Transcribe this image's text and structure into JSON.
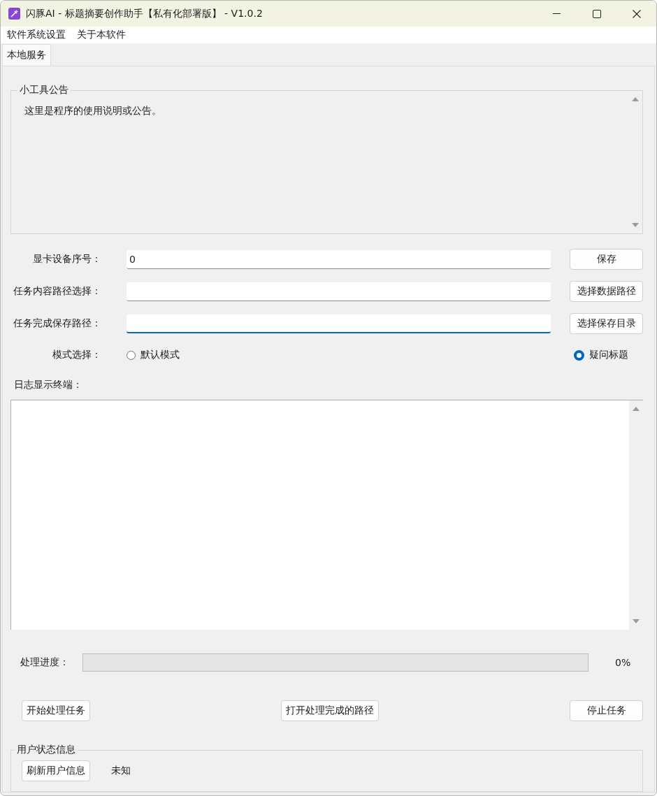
{
  "window": {
    "title": "闪豚AI - 标题摘要创作助手【私有化部署版】 - V1.0.2"
  },
  "menu": [
    "软件系统设置",
    "关于本软件"
  ],
  "tabs": [
    {
      "label": "本地服务",
      "selected": true
    }
  ],
  "notice": {
    "title": "小工具公告",
    "text": "这里是程序的使用说明或公告。"
  },
  "fields": [
    {
      "label": "显卡设备序号：",
      "value": "0",
      "focused": false,
      "button": "保存"
    },
    {
      "label": "任务内容路径选择：",
      "focused": false,
      "button": "选择数据路径"
    },
    {
      "label": "任务完成保存路径：",
      "focused": true,
      "button": "选择保存目录"
    }
  ],
  "mode": {
    "label": "模式选择：",
    "options": [
      {
        "label": "默认模式",
        "selected": false
      },
      {
        "label": "疑问标题",
        "selected": true
      }
    ]
  },
  "log": {
    "label": "日志显示终端："
  },
  "progress": {
    "label": "处理进度：",
    "level": 0,
    "reading": "0%"
  },
  "actions": [
    "开始处理任务",
    "打开处理完成的路径",
    "停止任务"
  ],
  "user": {
    "title": "用户状态信息",
    "button": "刷新用户信息",
    "status": "未知"
  }
}
